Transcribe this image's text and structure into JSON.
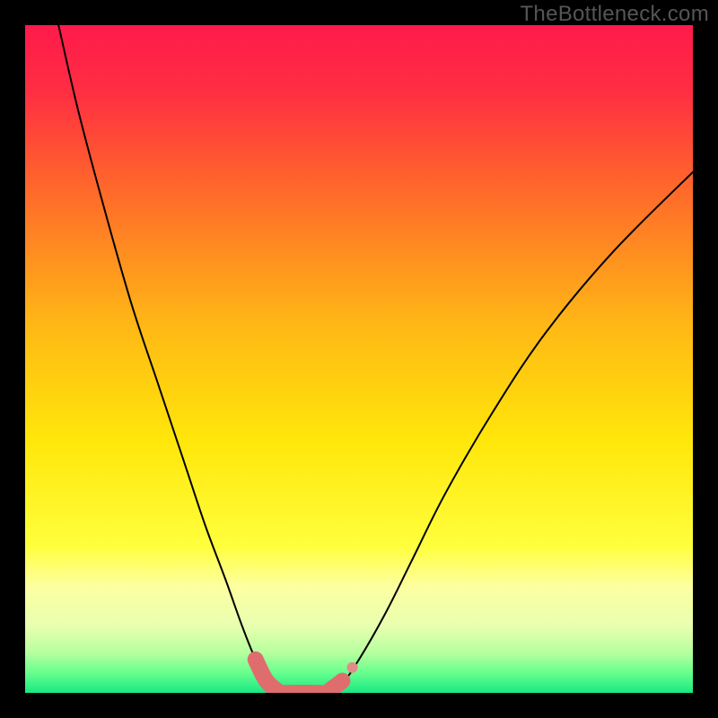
{
  "watermark": "TheBottleneck.com",
  "chart_data": {
    "type": "line",
    "title": "",
    "xlabel": "",
    "ylabel": "",
    "xlim": [
      0,
      100
    ],
    "ylim": [
      0,
      100
    ],
    "background_gradient": {
      "stops": [
        {
          "offset": 0.0,
          "color": "#ff1a4b"
        },
        {
          "offset": 0.1,
          "color": "#ff2e42"
        },
        {
          "offset": 0.25,
          "color": "#ff6a2a"
        },
        {
          "offset": 0.45,
          "color": "#ffb815"
        },
        {
          "offset": 0.62,
          "color": "#ffe60a"
        },
        {
          "offset": 0.78,
          "color": "#ffff3c"
        },
        {
          "offset": 0.84,
          "color": "#fdffa0"
        },
        {
          "offset": 0.9,
          "color": "#e8ffb0"
        },
        {
          "offset": 0.94,
          "color": "#b6ff9e"
        },
        {
          "offset": 0.97,
          "color": "#66ff8d"
        },
        {
          "offset": 1.0,
          "color": "#18e884"
        }
      ]
    },
    "series": [
      {
        "name": "bottleneck-curve",
        "color": "#000000",
        "width": 2,
        "x": [
          5.0,
          8.0,
          12.0,
          16.0,
          20.0,
          24.0,
          27.0,
          30.0,
          32.5,
          34.5,
          36.0,
          37.5,
          38.5,
          45.0,
          47.5,
          50.0,
          54.0,
          58.0,
          63.0,
          70.0,
          78.0,
          88.0,
          100.0
        ],
        "values": [
          100.0,
          87.0,
          72.0,
          58.0,
          46.0,
          34.0,
          25.0,
          17.0,
          10.0,
          5.0,
          2.0,
          0.5,
          0.0,
          0.0,
          1.5,
          5.0,
          12.0,
          20.0,
          30.0,
          42.0,
          54.0,
          66.0,
          78.0
        ]
      }
    ],
    "markers": {
      "name": "highlight-dots",
      "color": "#e06d6d",
      "radius": 3.4,
      "bar_radius": 9,
      "x": [
        34.5,
        36.0,
        37.5,
        38.5,
        40.0,
        42.0,
        43.5,
        45.0,
        46.2,
        47.5
      ],
      "values": [
        5.0,
        2.0,
        0.5,
        0.0,
        0.0,
        0.0,
        0.0,
        0.0,
        0.8,
        1.8
      ]
    },
    "extra_marker": {
      "x": 49.0,
      "y": 3.8,
      "r": 6,
      "color": "#e48a8a"
    }
  }
}
